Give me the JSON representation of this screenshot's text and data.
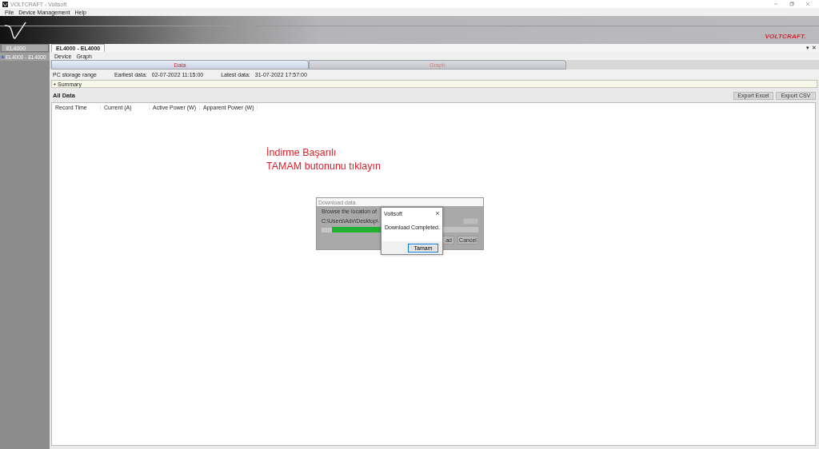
{
  "window": {
    "title": "VOLTCRAFT - Voltsoft"
  },
  "menu": [
    "File",
    "Device Management",
    "Help"
  ],
  "brand": {
    "logo": "VOLTCRAFT."
  },
  "sidebar": {
    "header": "EL4000",
    "items": [
      {
        "label": "EL4000 - EL4000",
        "selected": true
      }
    ]
  },
  "document_tabs": [
    {
      "label": "EL4000 - EL4000",
      "selected": true
    }
  ],
  "document_controls": [
    "▾",
    "✕"
  ],
  "submenu": [
    "Device",
    "Graph"
  ],
  "view_tabs": [
    {
      "label": "Data",
      "selected": true
    },
    {
      "label": "Graph",
      "selected": false
    }
  ],
  "storage": {
    "label": "PC storage range",
    "earliest_label": "Earliest data:",
    "earliest": "02-07-2022 11:15:00",
    "latest_label": "Latest data:",
    "latest": "31-07-2022 17:57:00"
  },
  "summary": {
    "label": "Summary",
    "expanded": false
  },
  "all_data": {
    "title": "All Data",
    "buttons": [
      "Export Excel",
      "Export CSV"
    ]
  },
  "table": {
    "columns": [
      "Record Time",
      "Current (A)",
      "Active Power (W)",
      "Apparent Power (W)"
    ]
  },
  "annotation": {
    "lines": [
      "İndirme Başarılı",
      "TAMAM butonunu tıklayın"
    ]
  },
  "download_dialog": {
    "title": "Download data",
    "prompt": "Browse the location of",
    "path": "C:\\Users\\Adv\\Desktop\\",
    "progress": {
      "level": 0.5
    },
    "buttons": [
      "ad",
      "Cancel"
    ]
  },
  "message_box": {
    "title": "Voltsoft",
    "message": "Download Completed.",
    "button": "Tamam"
  }
}
